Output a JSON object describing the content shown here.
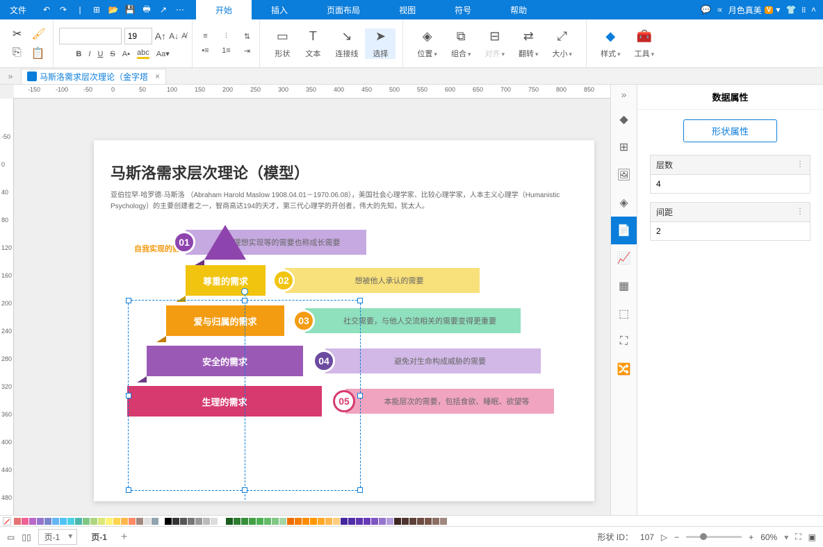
{
  "menubar": {
    "file": "文件",
    "tabs": [
      "开始",
      "插入",
      "页面布局",
      "视图",
      "符号",
      "帮助"
    ],
    "user": "月色真美",
    "vip": "V"
  },
  "ribbon": {
    "font_size": "19",
    "shape": "形状",
    "text": "文本",
    "connector": "连接线",
    "select": "选择",
    "position": "位置",
    "group": "组合",
    "align": "对齐",
    "flip": "翻转",
    "size": "大小",
    "style": "样式",
    "tools": "工具"
  },
  "doctab": {
    "title": "马斯洛需求层次理论（金字塔"
  },
  "page": {
    "title": "马斯洛需求层次理论（模型）",
    "subtitle": "亚伯拉罕·哈罗德·马斯洛 （Abraham Harold Maslow 1908.04.01－1970.06.08），美国社会心理学家、比较心理学家，人本主义心理学（Humanistic Psychology）的主要创建者之一，智商高达194的天才，第三代心理学的开创者，伟大的先知，犹太人。",
    "callout": "自我实现的需求",
    "levels": [
      {
        "num": "01",
        "seg": "",
        "desc": "对理想实现等的需要也称成长需要",
        "segColor": "#8e44ad",
        "circColor": "#8e44ad",
        "barColor": "#b98fd1"
      },
      {
        "num": "02",
        "seg": "尊重的需求",
        "desc": "想被他人承认的需要",
        "segColor": "#f1c40f",
        "circColor": "#f1c40f",
        "barColor": "#f8e07a"
      },
      {
        "num": "03",
        "seg": "爱与归属的需求",
        "desc": "社交需要，与他人交流相关的需要变得更重要",
        "segColor": "#f39c12",
        "circColor": "#f39c12",
        "barColor": "#7ed5b1"
      },
      {
        "num": "04",
        "seg": "安全的需求",
        "desc": "避免对生命构成威胁的需要",
        "segColor": "#9b59b6",
        "circColor": "#6b4aa0",
        "barColor": "#c6a9e0"
      },
      {
        "num": "05",
        "seg": "生理的需求",
        "desc": "本能层次的需要，包括食欲、睡眠、欲望等",
        "segColor": "#d63a6e",
        "circColor": "#d63a6e",
        "barColor": "#f0a4bf"
      }
    ]
  },
  "props": {
    "title": "数据属性",
    "shape_props_btn": "形状属性",
    "levels_label": "层数",
    "levels_value": "4",
    "spacing_label": "间距",
    "spacing_value": "2"
  },
  "statusbar": {
    "page_selector": "页-1",
    "page_tab": "页-1",
    "shape_id_label": "形状 ID：",
    "shape_id": "107",
    "zoom": "60%"
  }
}
